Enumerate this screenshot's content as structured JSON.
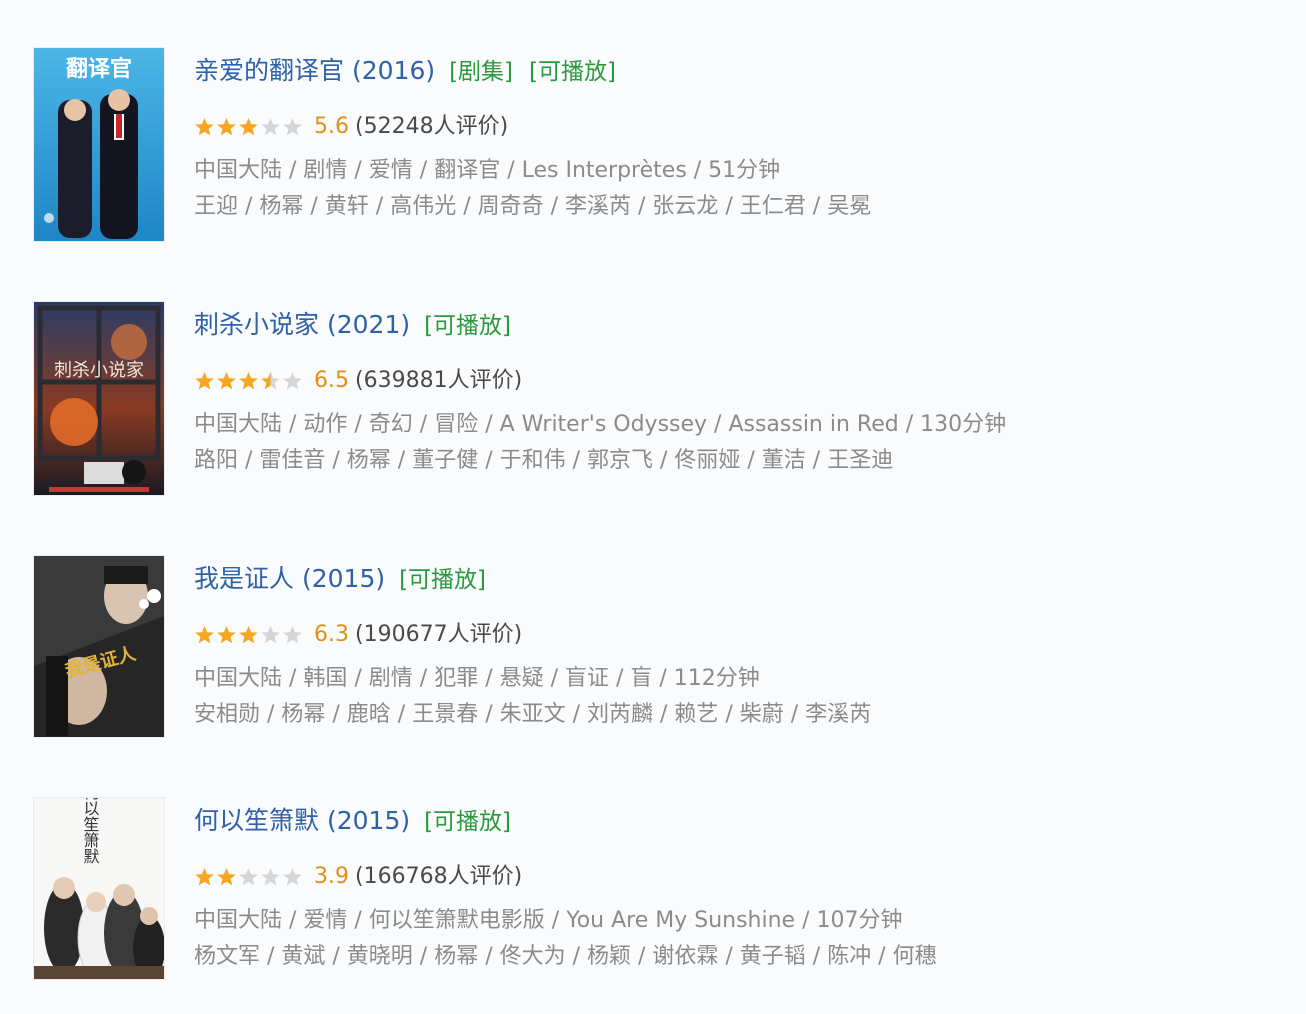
{
  "results": [
    {
      "title": "亲爱的翻译官",
      "year": "(2016)",
      "tags": [
        "[剧集]",
        "[可播放]"
      ],
      "rating_value": 5.6,
      "rating": "5.6",
      "votes": "(52248人评价)",
      "meta": "中国大陆 / 剧情 / 爱情 / 翻译官 / Les Interprètes / 51分钟",
      "cast": "王迎 / 杨幂 / 黄轩 / 高伟光 / 周奇奇 / 李溪芮 / 张云龙 / 王仁君 / 吴冕",
      "poster_icon": "poster-translator-drama",
      "poster_text": "翻译官"
    },
    {
      "title": "刺杀小说家",
      "year": "(2021)",
      "tags": [
        "[可播放]"
      ],
      "rating_value": 6.5,
      "rating": "6.5",
      "votes": "(639881人评价)",
      "meta": "中国大陆 / 动作 / 奇幻 / 冒险 / A Writer's Odyssey / Assassin in Red / 130分钟",
      "cast": "路阳 / 雷佳音 / 杨幂 / 董子健 / 于和伟 / 郭京飞 / 佟丽娅 / 董洁 / 王圣迪",
      "poster_icon": "poster-writer-odyssey",
      "poster_text": "刺杀小说家"
    },
    {
      "title": "我是证人",
      "year": "(2015)",
      "tags": [
        "[可播放]"
      ],
      "rating_value": 6.3,
      "rating": "6.3",
      "votes": "(190677人评价)",
      "meta": "中国大陆 / 韩国 / 剧情 / 犯罪 / 悬疑 / 盲证 / 盲 / 112分钟",
      "cast": "安相勋 / 杨幂 / 鹿晗 / 王景春 / 朱亚文 / 刘芮麟 / 赖艺 / 柴蔚 / 李溪芮",
      "poster_icon": "poster-witness",
      "poster_text": "我是证人"
    },
    {
      "title": "何以笙箫默",
      "year": "(2015)",
      "tags": [
        "[可播放]"
      ],
      "rating_value": 3.9,
      "rating": "3.9",
      "votes": "(166768人评价)",
      "meta": "中国大陆 / 爱情 / 何以笙箫默电影版 / You Are My Sunshine / 107分钟",
      "cast": "杨文军 / 黄斌 / 黄晓明 / 杨幂 / 佟大为 / 杨颖 / 谢依霖 / 黄子韬 / 陈冲 / 何穗",
      "poster_icon": "poster-sunshine",
      "poster_text": "何以笙箫默"
    }
  ],
  "colors": {
    "title": "#2e61a8",
    "tag": "#2a9a3e",
    "score": "#e09015",
    "meta": "#8b8b8b",
    "star_on": "#f5a623",
    "star_off": "#d6d6d6"
  }
}
